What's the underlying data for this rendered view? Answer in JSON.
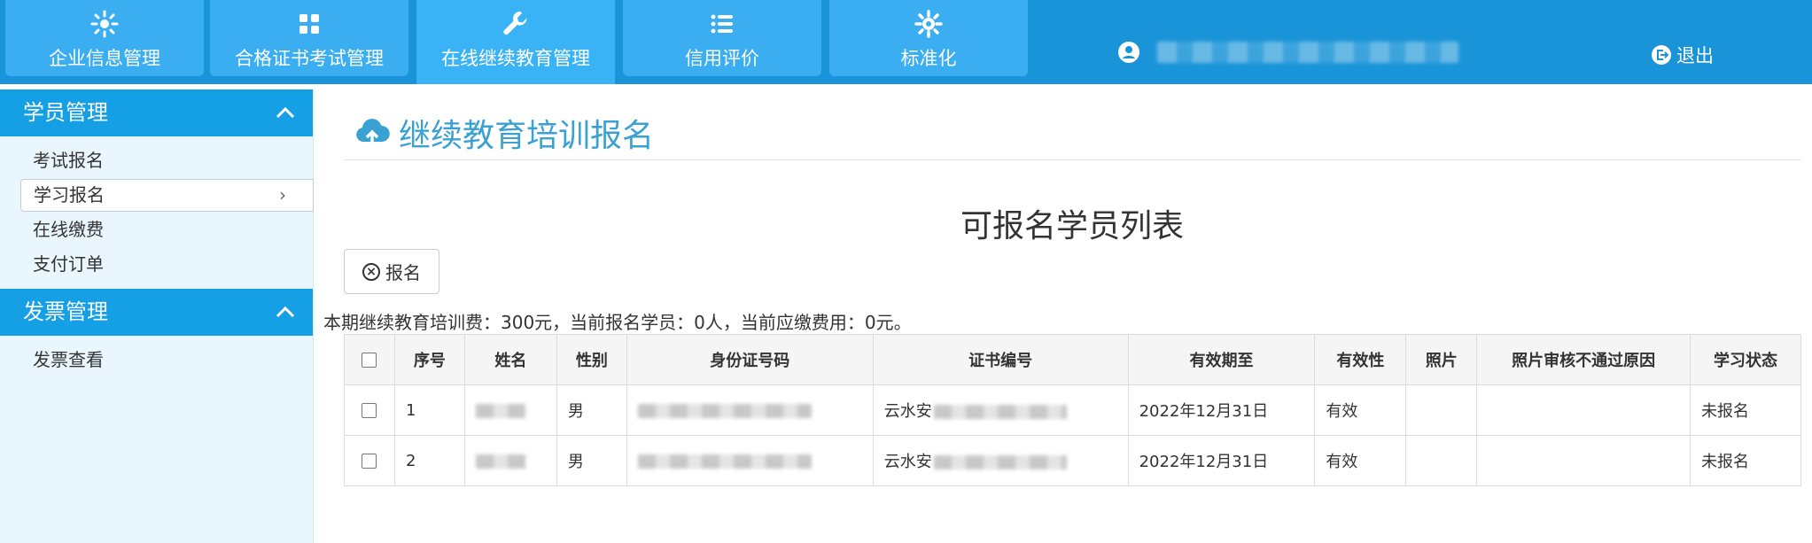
{
  "nav": {
    "tabs": [
      {
        "label": "企业信息管理",
        "icon": "gear-icon"
      },
      {
        "label": "合格证书考试管理",
        "icon": "grid-icon"
      },
      {
        "label": "在线继续教育管理",
        "icon": "wrench-icon"
      },
      {
        "label": "信用评价",
        "icon": "list-icon"
      },
      {
        "label": "标准化",
        "icon": "gear-icon"
      }
    ],
    "active_tab": "在线继续教育管理",
    "logout_label": "退出"
  },
  "sidebar": {
    "groups": [
      {
        "title": "学员管理",
        "items": [
          "考试报名",
          "学习报名",
          "在线缴费",
          "支付订单"
        ]
      },
      {
        "title": "发票管理",
        "items": [
          "发票查看"
        ]
      }
    ],
    "selected_item": "学习报名"
  },
  "main": {
    "page_title": "继续教育培训报名",
    "list_title": "可报名学员列表",
    "enroll_button": "报名",
    "fee_text": "本期继续教育培训费：300元，当前报名学员：0人，当前应缴费用：0元。",
    "table": {
      "headers": [
        "序号",
        "姓名",
        "性别",
        "身份证号码",
        "证书编号",
        "有效期至",
        "有效性",
        "照片",
        "照片审核不通过原因",
        "学习状态"
      ],
      "rows": [
        {
          "no": "1",
          "gender": "男",
          "cert_prefix": "云水安",
          "valid_until": "2022年12月31日",
          "validity": "有效",
          "status": "未报名"
        },
        {
          "no": "2",
          "gender": "男",
          "cert_prefix": "云水安",
          "valid_until": "2022年12月31日",
          "validity": "有效",
          "status": "未报名"
        }
      ]
    }
  },
  "colors": {
    "topbar": "#1a94d8",
    "tab": "#3aaef0",
    "sidebar_head": "#159fe4",
    "sidebar_bg": "#eaf6fd",
    "title": "#3aa1d3"
  }
}
